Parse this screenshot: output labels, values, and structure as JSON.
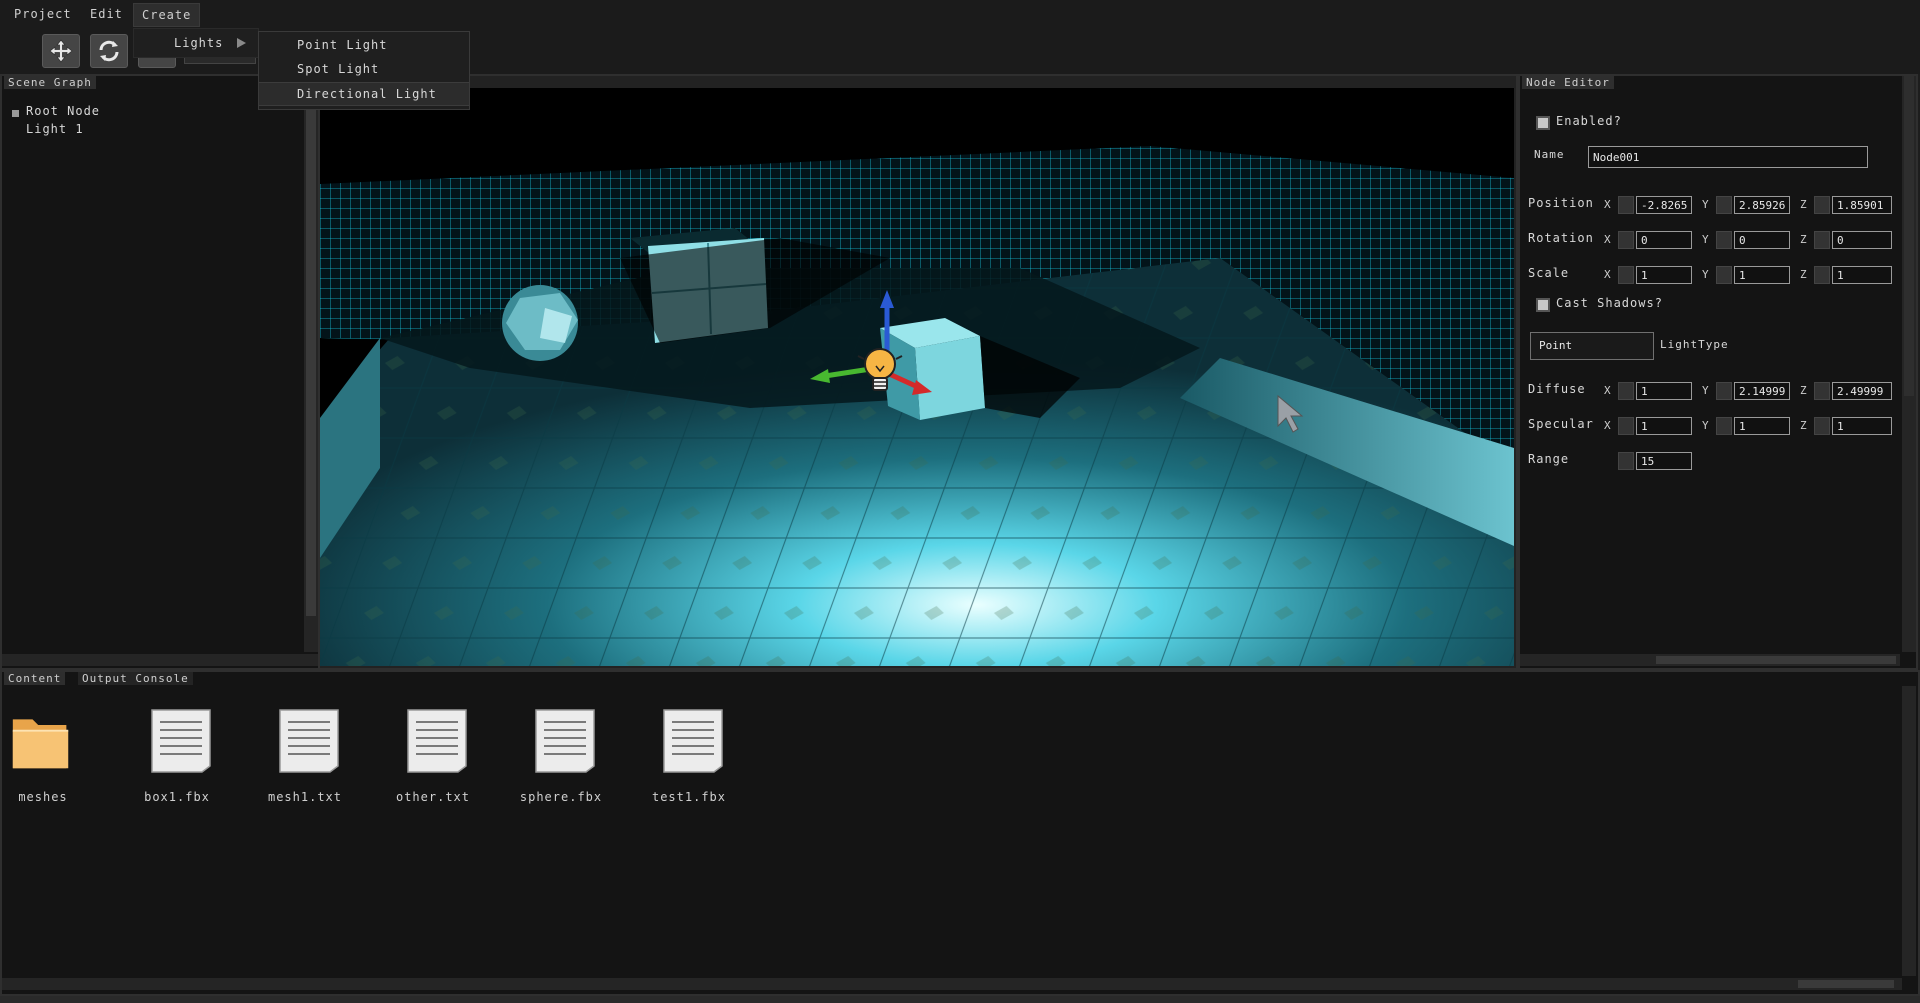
{
  "menubar": {
    "items": [
      "Project",
      "Edit",
      "Create"
    ]
  },
  "create_menu": {
    "lights_label": "Lights",
    "lights_submenu": [
      "Point Light",
      "Spot Light",
      "Directional Light"
    ]
  },
  "scene_graph": {
    "title": "Scene Graph",
    "items": [
      "Root Node",
      "Light 1"
    ]
  },
  "node_editor": {
    "title": "Node Editor",
    "enabled_label": "Enabled?",
    "name_label": "Name",
    "name_value": "Node001",
    "position_label": "Position",
    "position": [
      "-2.8265",
      "2.85926",
      "1.85901"
    ],
    "rotation_label": "Rotation",
    "rotation": [
      "0",
      "0",
      "0"
    ],
    "scale_label": "Scale",
    "scale": [
      "1",
      "1",
      "1"
    ],
    "cast_shadows_label": "Cast Shadows?",
    "light_type_value": "Point",
    "light_type_label": "LightType",
    "diffuse_label": "Diffuse",
    "diffuse": [
      "1",
      "2.14999",
      "2.49999"
    ],
    "specular_label": "Specular",
    "specular": [
      "1",
      "1",
      "1"
    ],
    "range_label": "Range",
    "range_value": "15",
    "axes": [
      "X",
      "Y",
      "Z"
    ]
  },
  "bottom_tabs": {
    "content": "Content",
    "output": "Output Console"
  },
  "content_files": [
    {
      "name": "meshes",
      "icon": "folder-icon"
    },
    {
      "name": "box1.fbx",
      "icon": "document-icon"
    },
    {
      "name": "mesh1.txt",
      "icon": "document-icon"
    },
    {
      "name": "other.txt",
      "icon": "document-icon"
    },
    {
      "name": "sphere.fbx",
      "icon": "document-icon"
    },
    {
      "name": "test1.fbx",
      "icon": "document-icon"
    }
  ],
  "colors": {
    "grid": "#16d6f0",
    "floor": "#5cc8d8",
    "gizmo_x": "#d42a2a",
    "gizmo_y": "#2a5ad4",
    "gizmo_z": "#48b830"
  }
}
